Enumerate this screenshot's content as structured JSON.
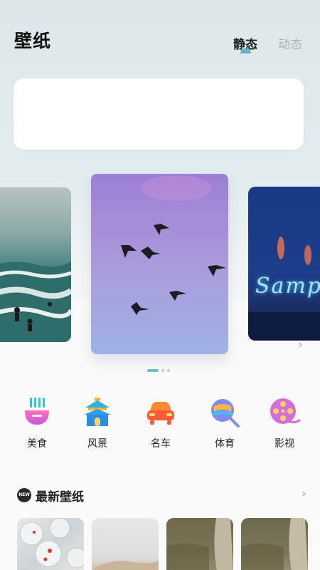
{
  "header": {
    "title": "壁纸",
    "tabs": [
      {
        "label": "静态",
        "active": true
      },
      {
        "label": "动态",
        "active": false
      }
    ]
  },
  "carousel": {
    "slides": [
      {
        "subject": "surfers on ocean waves"
      },
      {
        "subject": "birds flying in purple sky"
      },
      {
        "subject": "neon sign at night",
        "sign_text": "Samp"
      }
    ],
    "active_index": 1,
    "page_count": 3
  },
  "categories": [
    {
      "label": "美食",
      "icon": "noodle-bowl-icon"
    },
    {
      "label": "风景",
      "icon": "pagoda-icon"
    },
    {
      "label": "名车",
      "icon": "car-icon"
    },
    {
      "label": "体育",
      "icon": "badminton-icon"
    },
    {
      "label": "影视",
      "icon": "film-reel-icon"
    }
  ],
  "latest": {
    "badge": "NEW",
    "title": "最新壁纸",
    "thumbnails": [
      {
        "subject": "glass spheres with red accents"
      },
      {
        "subject": "hand on light background"
      },
      {
        "subject": "figure in olive field"
      },
      {
        "subject": "figure in olive field"
      }
    ]
  },
  "colors": {
    "accent": "#5fb3c8",
    "header_bg": "#dde8ea",
    "inactive_tab": "#aab4b6"
  }
}
